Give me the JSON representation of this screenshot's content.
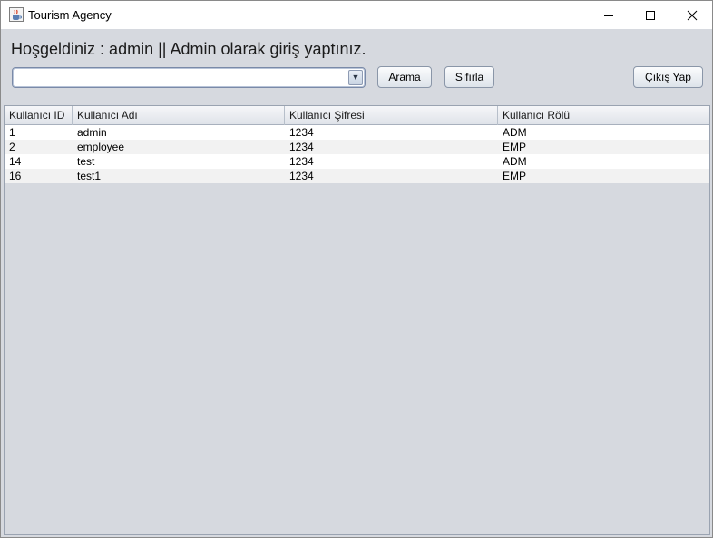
{
  "window": {
    "title": "Tourism Agency",
    "icon": "java-cup-icon"
  },
  "header": {
    "welcome": "Hoşgeldiniz : admin || Admin olarak giriş yaptınız."
  },
  "toolbar": {
    "combo_value": "",
    "search_label": "Arama",
    "reset_label": "Sıfırla",
    "logout_label": "Çıkış Yap"
  },
  "table": {
    "columns": [
      "Kullanıcı ID",
      "Kullanıcı Adı",
      "Kullanıcı Şifresi",
      "Kullanıcı Rölü"
    ],
    "rows": [
      [
        "1",
        "admin",
        "1234",
        "ADM"
      ],
      [
        "2",
        "employee",
        "1234",
        "EMP"
      ],
      [
        "14",
        "test",
        "1234",
        "ADM"
      ],
      [
        "16",
        "test1",
        "1234",
        "EMP"
      ]
    ]
  }
}
